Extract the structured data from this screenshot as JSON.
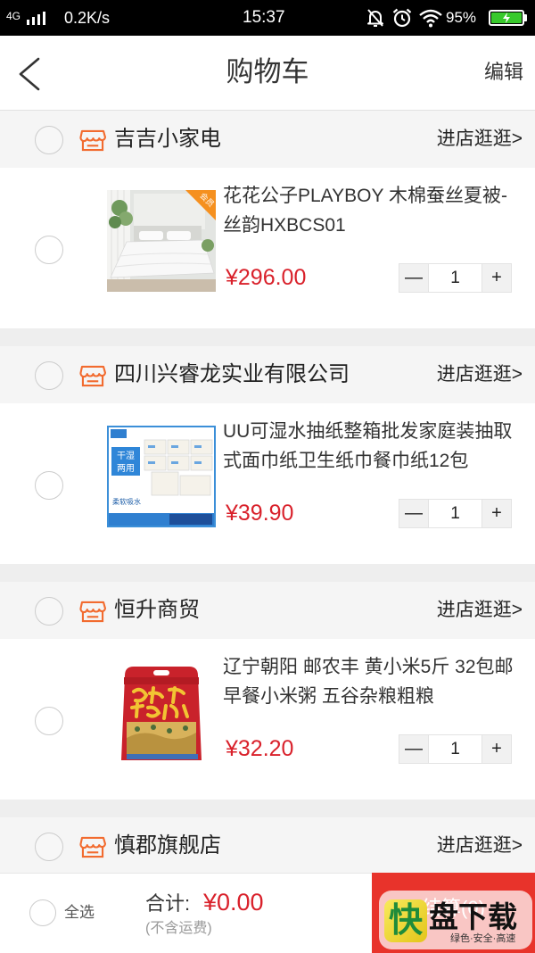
{
  "status_bar": {
    "network": "4G",
    "speed": "0.2K/s",
    "time": "15:37",
    "battery_percent": "95%",
    "icons": [
      "signal-icon",
      "mute-icon",
      "alarm-icon",
      "wifi-icon",
      "battery-charging-icon"
    ]
  },
  "header": {
    "back_icon": "chevron-left-icon",
    "title": "购物车",
    "edit_label": "编辑"
  },
  "colors": {
    "price_red": "#d9212b",
    "store_icon_orange": "#f26b2f",
    "checkout_red": "#e8332b"
  },
  "stepper": {
    "minus": "—",
    "plus": "+"
  },
  "stores": [
    {
      "name": "吉吉小家电",
      "enter_label": "进店逛逛>",
      "icon": "shop-icon",
      "items": [
        {
          "title": "花花公子PLAYBOY 木棉蚕丝夏被-丝韵HXBCS01",
          "price": "¥296.00",
          "quantity": "1",
          "badge": "会员"
        }
      ]
    },
    {
      "name": "四川兴睿龙实业有限公司",
      "enter_label": "进店逛逛>",
      "icon": "shop-icon",
      "items": [
        {
          "title": "UU可湿水抽纸整箱批发家庭装抽取式面巾纸卫生纸巾餐巾纸12包",
          "price": "¥39.90",
          "quantity": "1",
          "label_top": "干湿",
          "label_bottom": "两用",
          "caption": "柔软吸水"
        }
      ]
    },
    {
      "name": "恒升商贸",
      "enter_label": "进店逛逛>",
      "icon": "shop-icon",
      "items": [
        {
          "title": "辽宁朝阳 邮农丰 黄小米5斤 32包邮 早餐小米粥 五谷杂粮粗粮",
          "price": "¥32.20",
          "quantity": "1"
        }
      ]
    },
    {
      "name": "慎郡旗舰店",
      "enter_label": "进店逛逛>",
      "icon": "shop-icon",
      "items": []
    }
  ],
  "footer": {
    "select_all": "全选",
    "total_label": "合计:",
    "total_value": "¥0.00",
    "shipping_note": "(不含运费)",
    "checkout_label": "结算(0)"
  },
  "watermark": {
    "logo_char": "快",
    "name": "盘下载",
    "slogan": "绿色·安全·高速"
  }
}
